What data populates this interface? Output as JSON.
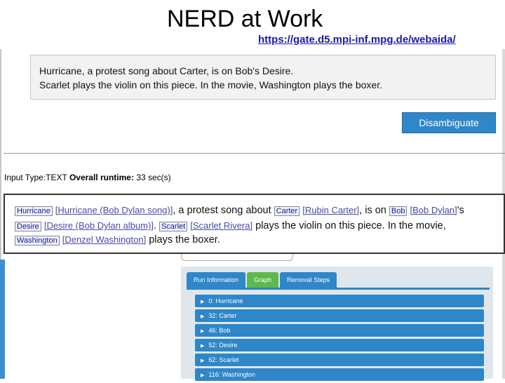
{
  "slide": {
    "title": "NERD at Work",
    "link": "https://gate.d5.mpi-inf.mpg.de/webaida/"
  },
  "input": {
    "line1": "Hurricane, a protest song about Carter, is on Bob's Desire.",
    "line2": "Scarlet plays the violin on this piece. In the movie, Washington plays the boxer."
  },
  "disambiguate_button": "Disambiguate",
  "meta": {
    "input_type_label": "Input Type:",
    "input_type_value": "TEXT",
    "runtime_label": "Overall runtime:",
    "runtime_value": "33 sec(s)"
  },
  "result": {
    "m1": "Hurricane",
    "e1": "[Hurricane (Bob Dylan song)]",
    "t1": ", a protest song about",
    "m2": "Carter",
    "e2": "[Rubin Carter]",
    "t2": ", is on",
    "m3": "Bob",
    "e3": "[Bob Dylan]",
    "t3": "'s",
    "m4": "Desire",
    "e4": "[Desire (Bob Dylan album)]",
    "t4": ".",
    "m5": "Scarlet",
    "e5": "[Scarlet Rivera]",
    "t5": " plays the violin on this piece. In the movie,",
    "m6": "Washington",
    "e6": "[Denzel Washington]",
    "t6": " plays the boxer."
  },
  "tabs": [
    "Run Information",
    "Graph",
    "Removal Steps"
  ],
  "mentions": [
    "0: Hurricane",
    "32: Carter",
    "46: Bob",
    "52: Desire",
    "62: Scarlet",
    "116: Washington"
  ],
  "colors": {
    "accent": "#2f86c8",
    "active_tab": "#5cb94a"
  }
}
